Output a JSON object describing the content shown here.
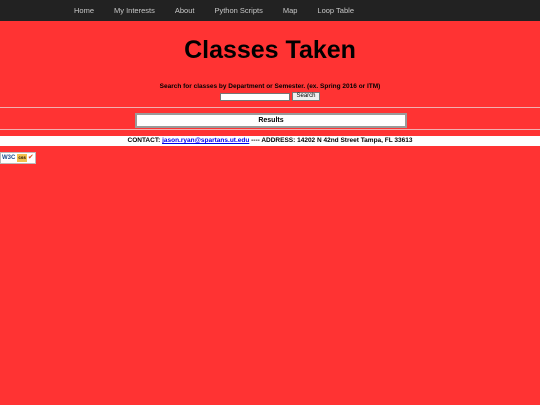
{
  "nav": {
    "items": [
      {
        "label": "Home"
      },
      {
        "label": "My Interests"
      },
      {
        "label": "About"
      },
      {
        "label": "Python Scripts"
      },
      {
        "label": "Map"
      },
      {
        "label": "Loop Table"
      }
    ]
  },
  "main": {
    "title": "Classes Taken",
    "search_instructions": "Search for classes by Department or Semester. (ex. Spring 2016 or ITM)",
    "search_value": "",
    "search_button_label": "Search",
    "results_label": "Results"
  },
  "footer": {
    "contact_label": "CONTACT:",
    "email": "jason.ryan@spartans.ut.edu",
    "address_text": "---- ADDRESS: 14202 N 42nd Street Tampa, FL 33613"
  },
  "badge": {
    "w3c_text": "W3C",
    "css_text": "css",
    "check": "✔",
    "icon": "w3c-css-valid-icon"
  },
  "colors": {
    "background": "#ff3333",
    "navbar": "#222222",
    "nav_text": "#c8c8c8",
    "link": "#0000ee"
  }
}
